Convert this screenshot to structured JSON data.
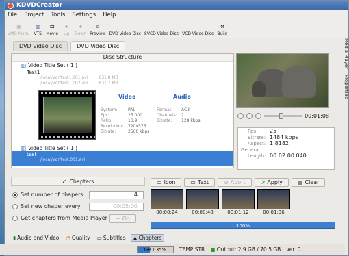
{
  "window": {
    "title": "KDVDCreator"
  },
  "menu": [
    "File",
    "Project",
    "Tools",
    "Settings",
    "Help"
  ],
  "toolbar": [
    {
      "label": "VMG Menu",
      "icon": "menu-icon",
      "disabled": true
    },
    {
      "label": "VTS",
      "icon": "vts-icon",
      "disabled": false
    },
    {
      "label": "Movie",
      "icon": "movie-icon",
      "disabled": false
    },
    {
      "label": "Up",
      "icon": "up-icon",
      "disabled": true
    },
    {
      "label": "Down",
      "icon": "down-icon",
      "disabled": true
    },
    {
      "label": "Preview",
      "icon": "preview-icon",
      "disabled": false
    },
    {
      "label": "DVD Video Disc",
      "icon": "dvd-icon",
      "disabled": false
    },
    {
      "label": "SVCD Video Disc",
      "icon": "svcd-icon",
      "disabled": false
    },
    {
      "label": "VCD Video Disc",
      "icon": "vcd-icon",
      "disabled": false
    },
    {
      "label": "Build",
      "icon": "build-icon",
      "disabled": false
    }
  ],
  "tabs": [
    "DVD Video Disc",
    "DVD Video Disc"
  ],
  "structure": {
    "header": "Disc Structure",
    "vts1": "Video Title Set ( 1 )",
    "title1": "Test1",
    "files": [
      {
        "name": "/local/vdr/test1.001.avi",
        "size": "831.8 MB"
      },
      {
        "name": "/local/vdr/test1.002.avi",
        "size": "831.7 MB"
      }
    ],
    "video_header": "Video",
    "audio_header": "Audio",
    "video_keys": [
      "System:",
      "Fps:",
      "Ratio:",
      "Resolution:",
      "Bitrate:"
    ],
    "video_vals": [
      "PAL",
      "25.000",
      "16:9",
      "720x576",
      "2500 kbps"
    ],
    "audio_keys": [
      "Format:",
      "Channels:",
      "Bitrate:"
    ],
    "audio_vals": [
      "AC3",
      "2",
      "128 kbps"
    ],
    "vts2": "Video Title Set ( 1 )",
    "title2": "test",
    "title2_file": "/local/vdr/test.001.avi"
  },
  "player": {
    "time": "00:01:08"
  },
  "properties": [
    {
      "k": "Fps:",
      "v": "25"
    },
    {
      "k": "Bitrate:",
      "v": "1484 kbps"
    },
    {
      "k": "Aspect:",
      "v": "1.8182"
    },
    {
      "k": "General",
      "v": ""
    },
    {
      "k": "Length:",
      "v": "00:02:00.040"
    }
  ],
  "side_tabs": [
    "Media Player",
    "Properties"
  ],
  "chapters": {
    "title": "Chapters",
    "opt1": "Set number of chapers",
    "opt1_value": "4",
    "opt2": "Set new chaper every",
    "opt2_value": "00:05:00",
    "opt3": "Get chapters from Media Player",
    "opt3_btn": "Go"
  },
  "panel_buttons": [
    {
      "label": "Icon",
      "disabled": false
    },
    {
      "label": "Text",
      "disabled": false
    },
    {
      "label": "Abort",
      "disabled": true
    },
    {
      "label": "Apply",
      "disabled": false
    },
    {
      "label": "Clear",
      "disabled": false
    }
  ],
  "thumbs": [
    "00:00:24",
    "00:00:48",
    "00:01:12",
    "00:01:36"
  ],
  "progress": {
    "label": "100%",
    "value": 100
  },
  "bottom_tabs": [
    "Audio and Video",
    "Quality",
    "Subtitles",
    "Chapters"
  ],
  "status": {
    "capacity": "GB / 35%",
    "mode": "TEMP STR",
    "output": "Output: 2.9 GB / 70.5 GB",
    "ver": "ver. 0."
  }
}
